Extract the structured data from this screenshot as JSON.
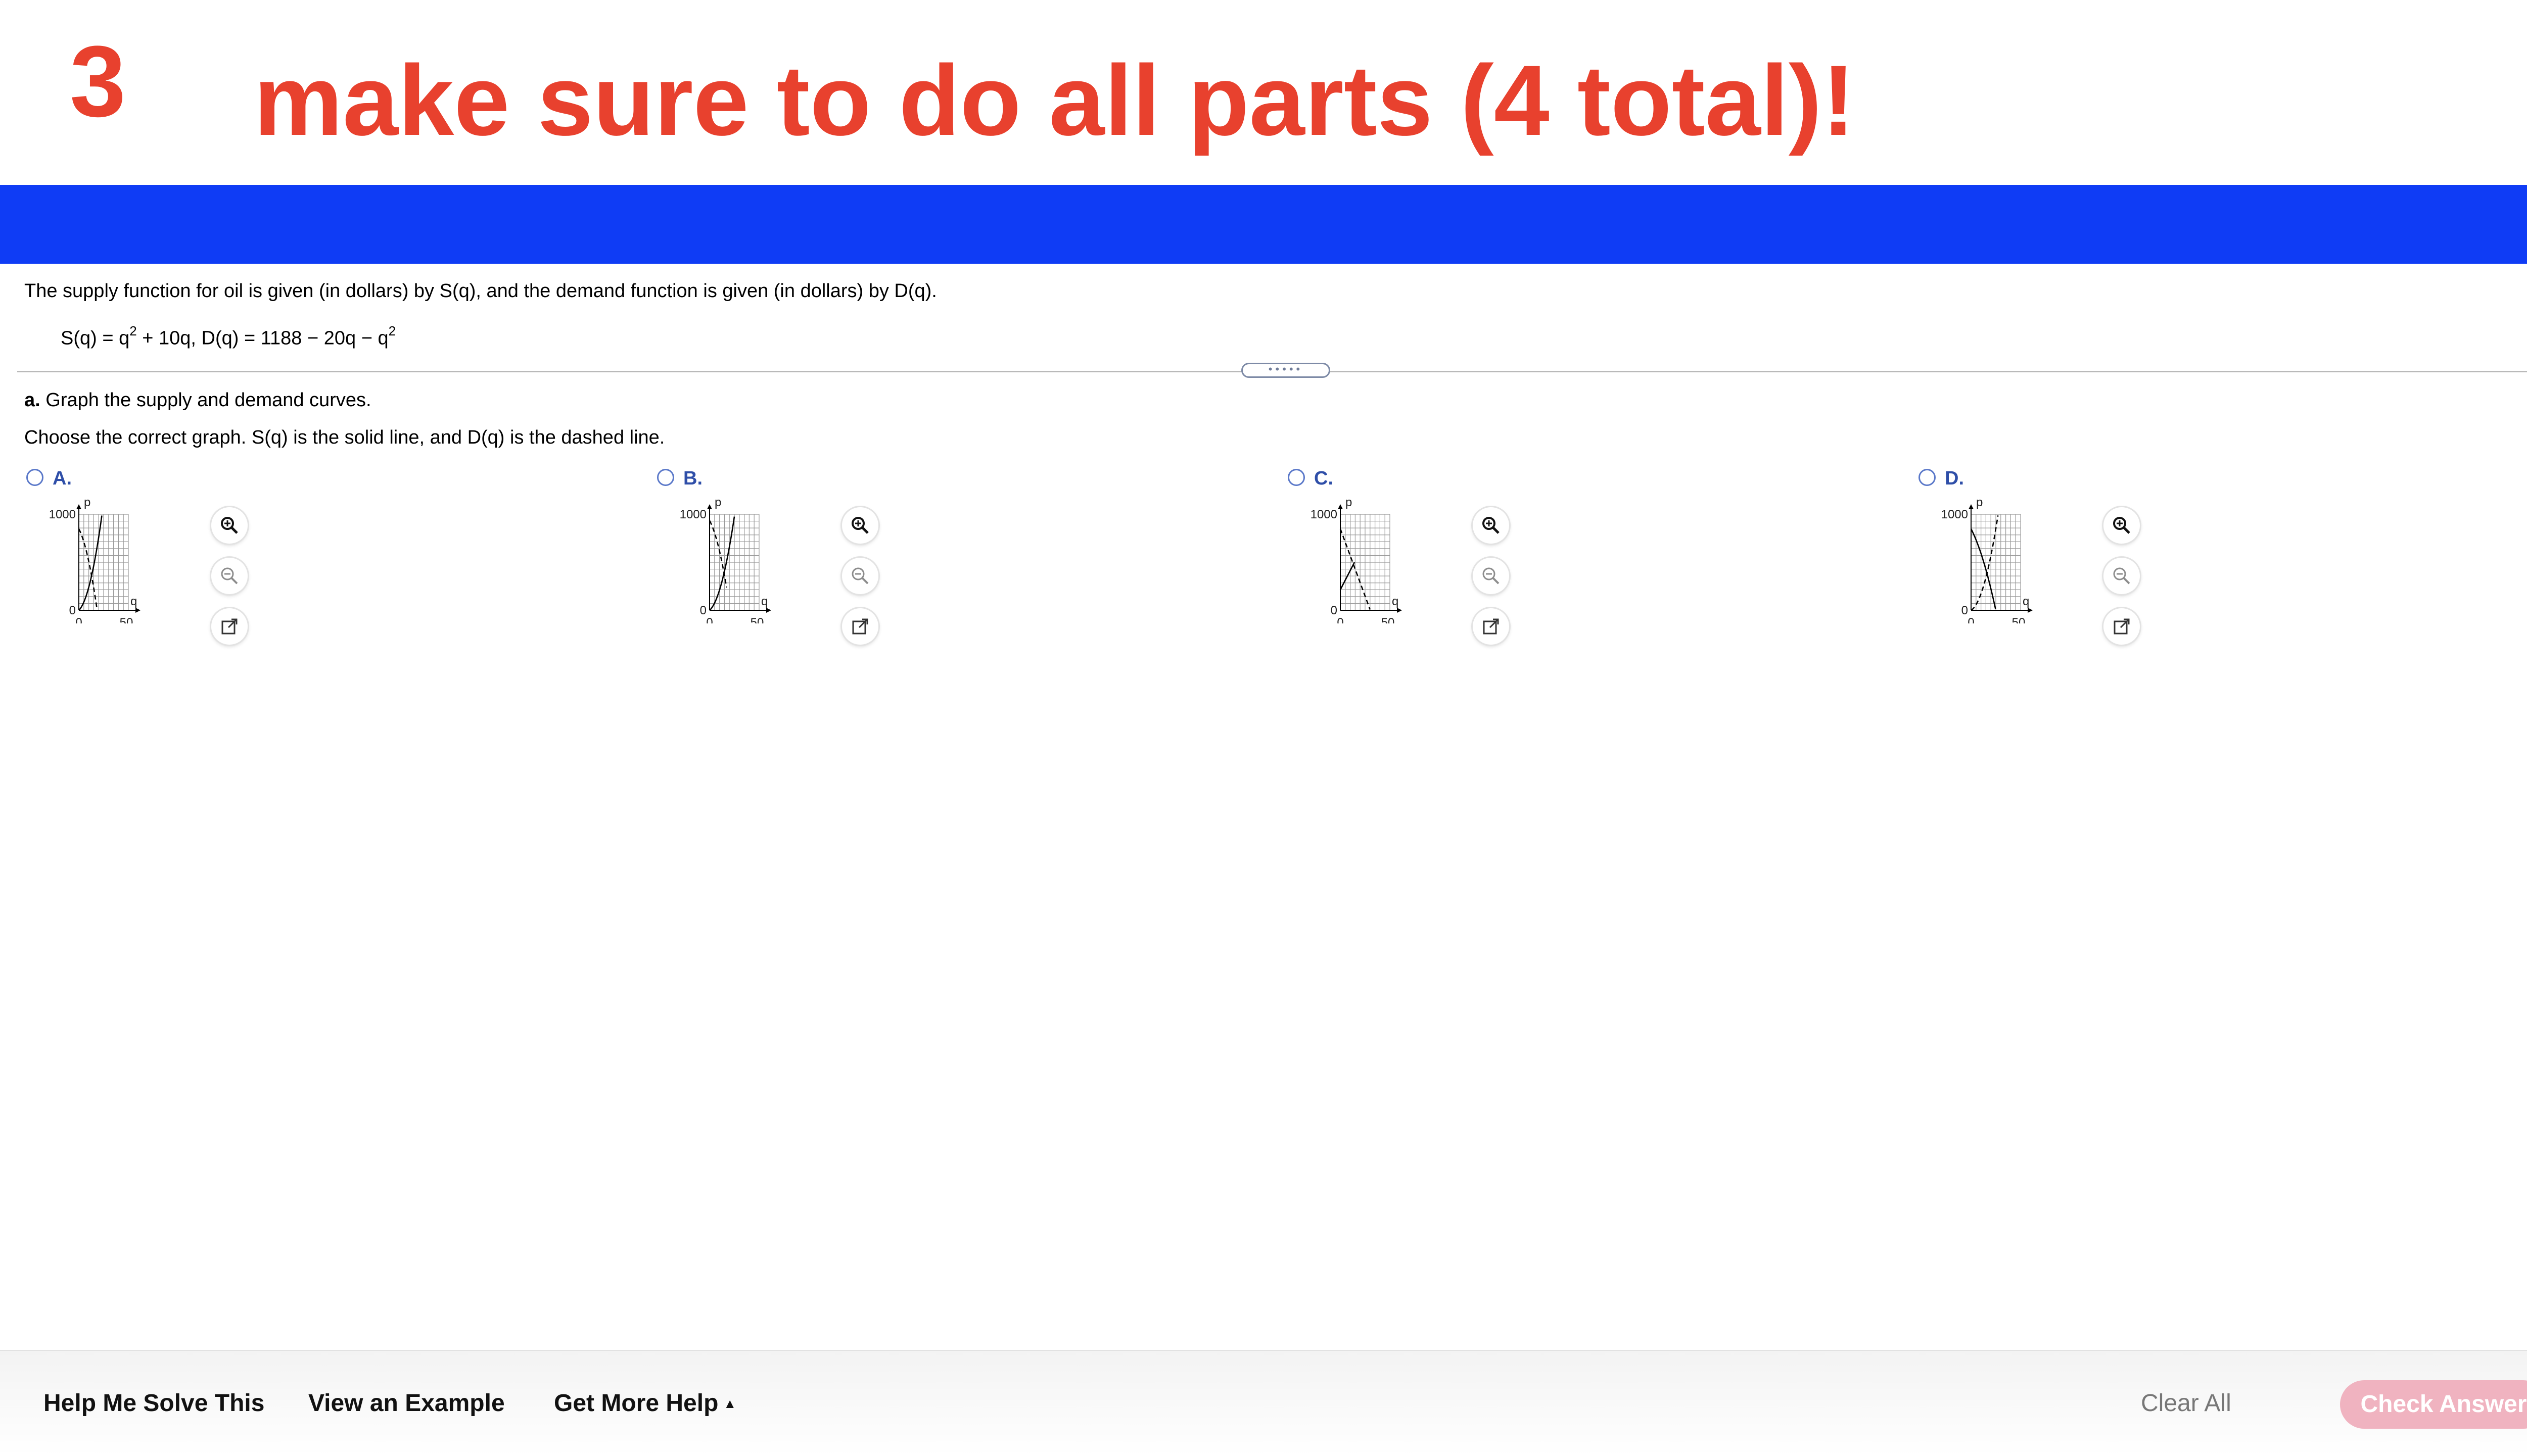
{
  "header": {
    "question_number": "3",
    "banner_title": "make sure to do all parts (4 total)!",
    "accent_color": "#e8412e",
    "bar_color": "#0f3cf5"
  },
  "problem": {
    "intro": "The supply function for oil is given (in dollars) by S(q), and the demand function is given (in dollars) by D(q).",
    "formula_s_left": "S(q) = q",
    "formula_s_right": " + 10q,  D(q) = 1188 − 20q − q",
    "exponent": "2",
    "divider_dots": "•••••",
    "part_label": "a.",
    "part_text": " Graph the supply and demand curves.",
    "instruction": "Choose the correct graph.  S(q) is the solid line, and D(q) is the dashed line."
  },
  "options": [
    {
      "letter": "A.",
      "y_tick": "1000",
      "y_zero": "0",
      "x_zero": "0",
      "x_tick": "50",
      "y_axis": "p",
      "x_axis": "q"
    },
    {
      "letter": "B.",
      "y_tick": "1000",
      "y_zero": "0",
      "x_zero": "0",
      "x_tick": "50",
      "y_axis": "p",
      "x_axis": "q"
    },
    {
      "letter": "C.",
      "y_tick": "1000",
      "y_zero": "0",
      "x_zero": "0",
      "x_tick": "50",
      "y_axis": "p",
      "x_axis": "q"
    },
    {
      "letter": "D.",
      "y_tick": "1000",
      "y_zero": "0",
      "x_zero": "0",
      "x_tick": "50",
      "y_axis": "p",
      "x_axis": "q"
    }
  ],
  "tools": {
    "zoom_in_icon": "zoom-in-icon",
    "zoom_out_icon": "zoom-out-icon",
    "popout_icon": "popout-icon"
  },
  "footer": {
    "help_solve": "Help Me Solve This",
    "view_example": "View an Example",
    "more_help": "Get More Help",
    "more_help_caret": "▲",
    "clear_all": "Clear All",
    "check_answer": "Check Answer"
  }
}
